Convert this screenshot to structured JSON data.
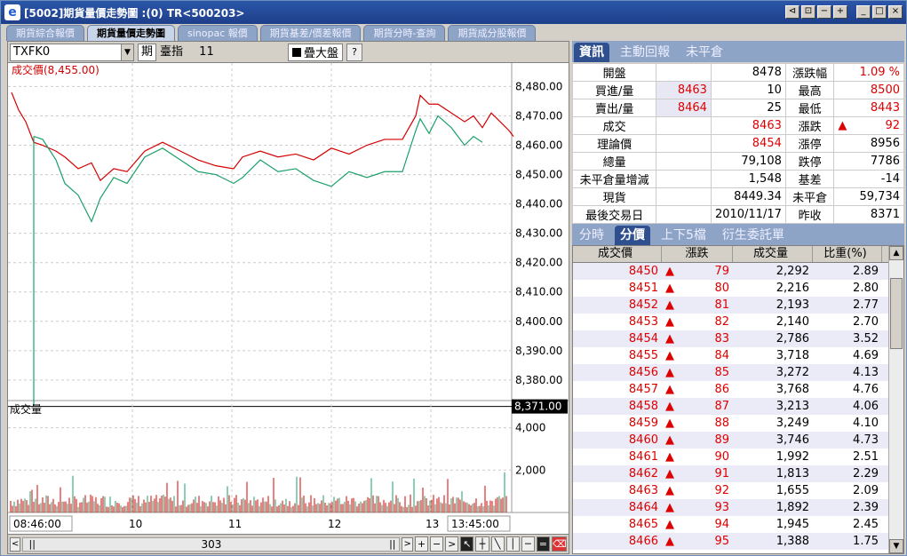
{
  "window": {
    "title": "[5002]期貨量價走勢圖 :(0) TR<500203>",
    "controls": [
      "⊲",
      "⊡",
      "−",
      "+",
      "_",
      "□",
      "×"
    ]
  },
  "tabs": [
    "期貨綜合報價",
    "期貨量價走勢圖",
    "sinopac 報價",
    "期貨基差/價差報價",
    "期貨分時-查詢",
    "期貨成分股報價"
  ],
  "toolbar": {
    "symbol": "TXFK0",
    "type_label": "期",
    "index_name": "臺指",
    "index_month": "11",
    "overlay_label": "疊大盤",
    "help_label": "?"
  },
  "chart_data": {
    "type": "line",
    "price_label": "成交價(8,455.00)",
    "volume_label": "成交量",
    "x_ticks": [
      "08:46:00",
      "10",
      "11",
      "12",
      "13",
      "13:45:00"
    ],
    "price_ticks": [
      "8,480.00",
      "8,470.00",
      "8,460.00",
      "8,450.00",
      "8,440.00",
      "8,430.00",
      "8,420.00",
      "8,410.00",
      "8,400.00",
      "8,390.00",
      "8,380.00"
    ],
    "price_ylim": [
      8373,
      8488
    ],
    "ref_price": "8,371.00",
    "volume_ticks": [
      "4,000",
      "2,000"
    ],
    "volume_ylim": [
      0,
      5200
    ],
    "series": [
      {
        "color": "#d40000",
        "x": [
          0,
          8,
          16,
          25,
          35,
          50,
          60,
          75,
          90,
          100,
          115,
          130,
          150,
          170,
          190,
          210,
          230,
          250,
          260,
          280,
          300,
          320,
          340,
          360,
          380,
          400,
          420,
          440,
          455,
          460,
          470,
          480,
          495,
          510,
          520,
          530,
          540,
          550,
          560,
          565
        ],
        "values": [
          8478,
          8472,
          8468,
          8461,
          8460,
          8458,
          8456,
          8452,
          8454,
          8448,
          8452,
          8451,
          8458,
          8461,
          8458,
          8455,
          8453,
          8452,
          8456,
          8458,
          8456,
          8457,
          8455,
          8459,
          8457,
          8460,
          8462,
          8462,
          8470,
          8477,
          8474,
          8474,
          8471,
          8468,
          8470,
          8466,
          8471,
          8468,
          8465,
          8463
        ]
      },
      {
        "color": "#1aa06a",
        "x": [
          25,
          35,
          50,
          60,
          75,
          90,
          100,
          115,
          130,
          150,
          170,
          190,
          210,
          230,
          250,
          260,
          280,
          300,
          320,
          340,
          360,
          380,
          400,
          420,
          440,
          455,
          460,
          470,
          480,
          495,
          510,
          520,
          530
        ],
        "values": [
          8463,
          8462,
          8455,
          8447,
          8443,
          8434,
          8442,
          8449,
          8447,
          8456,
          8459,
          8455,
          8451,
          8450,
          8447,
          8449,
          8455,
          8451,
          8452,
          8448,
          8446,
          8451,
          8449,
          8451,
          8451,
          8465,
          8469,
          8464,
          8470,
          8466,
          8460,
          8463,
          8461
        ]
      }
    ]
  },
  "scroll": {
    "value": "303"
  },
  "right_tabs": [
    "資訊",
    "主動回報",
    "未平倉"
  ],
  "info_rows": [
    [
      {
        "t": "開盤"
      },
      {
        "t": "",
        "cls": ""
      },
      {
        "t": "8478",
        "cls": "c3"
      },
      {
        "t": "漲跌幅"
      },
      {
        "t": "1.09 %",
        "cls": "red"
      }
    ],
    [
      {
        "t": "買進/量"
      },
      {
        "t": "8463",
        "cls": "red hl"
      },
      {
        "t": "10",
        "cls": ""
      },
      {
        "t": "最高"
      },
      {
        "t": "8500",
        "cls": "red"
      }
    ],
    [
      {
        "t": "賣出/量"
      },
      {
        "t": "8464",
        "cls": "red hl"
      },
      {
        "t": "25",
        "cls": ""
      },
      {
        "t": "最低"
      },
      {
        "t": "8443",
        "cls": "red"
      }
    ],
    [
      {
        "t": "成交"
      },
      {
        "t": "",
        "cls": ""
      },
      {
        "t": "8463",
        "cls": "red"
      },
      {
        "t": "漲跌"
      },
      {
        "t": "92",
        "cls": "red",
        "arrow": "▲"
      }
    ],
    [
      {
        "t": "理論價"
      },
      {
        "t": "",
        "cls": ""
      },
      {
        "t": "8454",
        "cls": "red"
      },
      {
        "t": "漲停"
      },
      {
        "t": "8956",
        "cls": ""
      }
    ],
    [
      {
        "t": "總量"
      },
      {
        "t": "",
        "cls": ""
      },
      {
        "t": "79,108",
        "cls": ""
      },
      {
        "t": "跌停"
      },
      {
        "t": "7786",
        "cls": ""
      }
    ],
    [
      {
        "t": "未平倉量增減"
      },
      {
        "t": "",
        "cls": ""
      },
      {
        "t": "1,548",
        "cls": ""
      },
      {
        "t": "基差"
      },
      {
        "t": "-14",
        "cls": ""
      }
    ],
    [
      {
        "t": "現貨"
      },
      {
        "t": "",
        "cls": ""
      },
      {
        "t": "8449.34",
        "cls": ""
      },
      {
        "t": "未平倉"
      },
      {
        "t": "59,734",
        "cls": ""
      }
    ],
    [
      {
        "t": "最後交易日"
      },
      {
        "t": "",
        "cls": ""
      },
      {
        "t": "2010/11/17",
        "cls": ""
      },
      {
        "t": "昨收"
      },
      {
        "t": "8371",
        "cls": ""
      }
    ]
  ],
  "lower_tabs": [
    "分時",
    "分價",
    "上下5檔",
    "衍生委託單"
  ],
  "list_headers": [
    "成交價",
    "漲跌",
    "成交量",
    "比重(%)"
  ],
  "list_rows": [
    [
      "8450",
      "79",
      "2,292",
      "2.89"
    ],
    [
      "8451",
      "80",
      "2,216",
      "2.80"
    ],
    [
      "8452",
      "81",
      "2,193",
      "2.77"
    ],
    [
      "8453",
      "82",
      "2,140",
      "2.70"
    ],
    [
      "8454",
      "83",
      "2,786",
      "3.52"
    ],
    [
      "8455",
      "84",
      "3,718",
      "4.69"
    ],
    [
      "8456",
      "85",
      "3,272",
      "4.13"
    ],
    [
      "8457",
      "86",
      "3,768",
      "4.76"
    ],
    [
      "8458",
      "87",
      "3,213",
      "4.06"
    ],
    [
      "8459",
      "88",
      "3,249",
      "4.10"
    ],
    [
      "8460",
      "89",
      "3,746",
      "4.73"
    ],
    [
      "8461",
      "90",
      "1,992",
      "2.51"
    ],
    [
      "8462",
      "91",
      "1,813",
      "2.29"
    ],
    [
      "8463",
      "92",
      "1,655",
      "2.09"
    ],
    [
      "8464",
      "93",
      "1,892",
      "2.39"
    ],
    [
      "8465",
      "94",
      "1,945",
      "2.45"
    ],
    [
      "8466",
      "95",
      "1,388",
      "1.75"
    ]
  ],
  "up_arrow": "▲"
}
